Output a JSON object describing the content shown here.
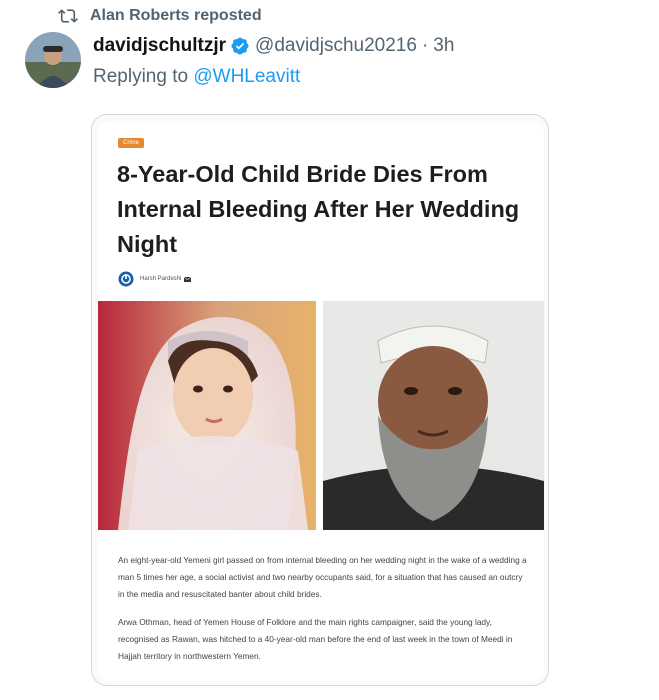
{
  "repost": {
    "label": "Alan Roberts reposted",
    "icon": "repost-icon"
  },
  "author": {
    "display_name": "davidjschultzjr",
    "handle": "@davidjschu20216",
    "separator": "·",
    "time": "3h",
    "verified": true,
    "verified_color": "#1d9bf0"
  },
  "reply": {
    "prefix": "Replying to ",
    "mention": "@WHLeavitt"
  },
  "article": {
    "tag": "Crime",
    "headline": "8-Year-Old Child Bride Dies From Internal Bleeding After Her Wedding Night",
    "author_name": "Harsh Pardeshi",
    "paragraph_1": "An eight-year-old Yemeni girl passed on from internal bleeding on her wedding night in the wake of a wedding a man 5 times her age, a social activist and two nearby occupants said, for a situation that has caused an outcry in the media and resuscitated banter about child brides.",
    "paragraph_2": "Arwa Othman, head of Yemen House of Folklore and the main rights campaigner, said the young lady, recognised as Rawan, was hitched to a 40-year-old man before the end of last week in the town of Meedi in Hajjah territory in northwestern Yemen."
  },
  "colors": {
    "link": "#1d9bf0",
    "secondary_text": "#536471",
    "tag": "#e4892f"
  }
}
